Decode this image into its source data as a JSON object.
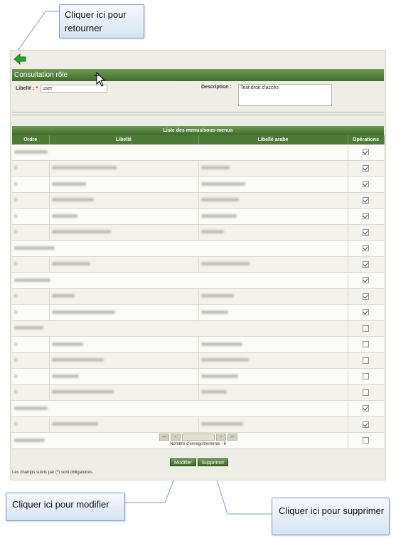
{
  "callouts": {
    "back": "Cliquer ici pour retourner",
    "edit": "Cliquer ici pour modifier",
    "delete": "Cliquer ici pour supprimer"
  },
  "panel": {
    "title": "Consultation rôle",
    "libelle_label": "Libellé :",
    "required_mark": "*",
    "libelle_value": "user",
    "description_label": "Description :",
    "description_value": "Test droit d'accès"
  },
  "table": {
    "caption": "Liste des menus/sous-menus",
    "columns": [
      "Ordre",
      "Libellé",
      "Libellé arabe",
      "Opérations"
    ],
    "rows": [
      {
        "type": "group",
        "checked": true
      },
      {
        "type": "item",
        "checked": true
      },
      {
        "type": "item",
        "checked": true
      },
      {
        "type": "item",
        "checked": true
      },
      {
        "type": "item",
        "checked": true
      },
      {
        "type": "item",
        "checked": true
      },
      {
        "type": "group",
        "checked": true
      },
      {
        "type": "item",
        "checked": true
      },
      {
        "type": "group",
        "checked": true
      },
      {
        "type": "item",
        "checked": true
      },
      {
        "type": "item",
        "checked": true
      },
      {
        "type": "group",
        "checked": false
      },
      {
        "type": "item",
        "checked": false
      },
      {
        "type": "item",
        "checked": false
      },
      {
        "type": "item",
        "checked": false
      },
      {
        "type": "item",
        "checked": false
      },
      {
        "type": "group",
        "checked": true
      },
      {
        "type": "item",
        "checked": true
      },
      {
        "type": "group",
        "checked": false
      }
    ]
  },
  "pager": {
    "first": "<<",
    "prev": "<",
    "next": ">",
    "last": ">>",
    "record_count": "Nombre d'enregistrements : 6"
  },
  "buttons": {
    "modify": "Modifier",
    "delete": "Supprimer"
  },
  "footer_note": "Les champs suivis par (*) sont obligatoires.",
  "icons": {
    "back": "green-left-arrow-icon",
    "cursor": "mouse-pointer-icon",
    "checkbox": "checkbox-icon"
  },
  "colors": {
    "header_green": "#4e7a37",
    "panel_bg": "#efeee6",
    "callout_border": "#7d9bc4"
  }
}
